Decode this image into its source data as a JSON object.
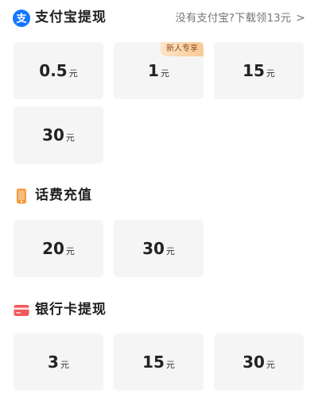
{
  "alipay": {
    "title": "支付宝提现",
    "icon": "alipay-icon",
    "icon_glyph": "支",
    "icon_color": "#1677ff",
    "link_text": "没有支付宝?下载领13元",
    "link_arrow": ">",
    "options": [
      {
        "amount": "0.5",
        "unit": "元"
      },
      {
        "amount": "1",
        "unit": "元",
        "badge": "新人专享"
      },
      {
        "amount": "15",
        "unit": "元"
      },
      {
        "amount": "30",
        "unit": "元"
      }
    ]
  },
  "phone": {
    "title": "话费充值",
    "icon": "phone-icon",
    "icon_color": "#f39a3d",
    "options": [
      {
        "amount": "20",
        "unit": "元"
      },
      {
        "amount": "30",
        "unit": "元"
      }
    ]
  },
  "bank": {
    "title": "银行卡提现",
    "icon": "bank-card-icon",
    "icon_color": "#f25a5a",
    "options": [
      {
        "amount": "3",
        "unit": "元"
      },
      {
        "amount": "15",
        "unit": "元"
      },
      {
        "amount": "30",
        "unit": "元"
      }
    ]
  },
  "colors": {
    "tile_bg": "#f5f5f5",
    "badge_bg": "#f9c997",
    "badge_text": "#8a4f1a"
  }
}
